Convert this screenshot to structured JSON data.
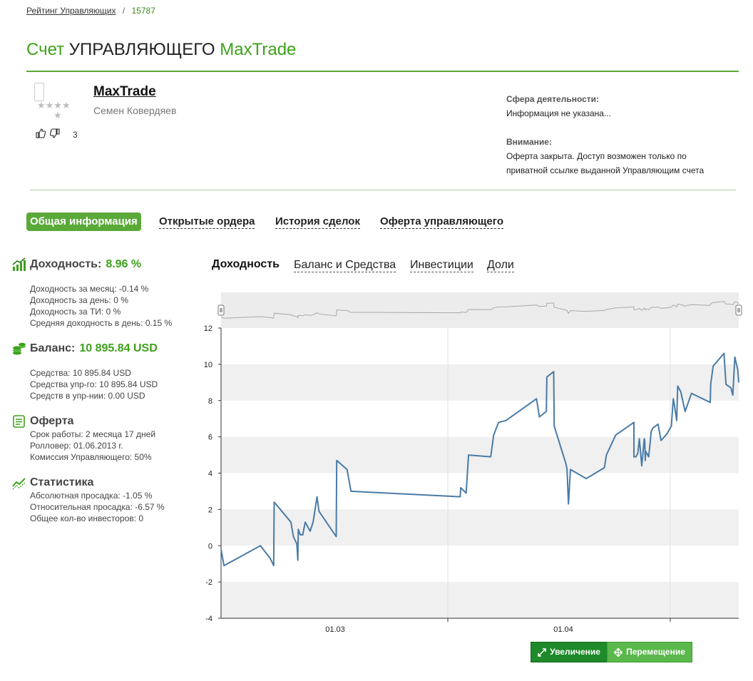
{
  "breadcrumb": {
    "link": "Рейтинг Управляющих",
    "separator": "/",
    "current": "15787"
  },
  "title": {
    "part1": "Счет",
    "part2": "УПРАВЛЯЮЩЕГО",
    "part3": "MaxTrade"
  },
  "profile": {
    "name": "MaxTrade",
    "full_name": "Семен Ковердяев",
    "rating_stars": "★★★★",
    "rating_star_last": "★",
    "votes": "3"
  },
  "info": {
    "sphere_label": "Сфера деятельности:",
    "sphere_value": "Информация не указана...",
    "attention_label": "Внимание:",
    "attention_line1": "Оферта закрыта. Доступ возможен только по",
    "attention_line2": "приватной ссылке выданной Управляющим счета"
  },
  "tabs": [
    "Общая информация",
    "Открытые ордера",
    "История сделок",
    "Оферта управляющего"
  ],
  "stats": {
    "yield": {
      "label": "Доходность:",
      "value": "8.96 %",
      "lines": [
        "Доходность за месяц: -0.14 %",
        "Доходность за день: 0 %",
        "Доходность за ТИ: 0 %",
        "Средняя доходность в день: 0.15 %"
      ]
    },
    "balance": {
      "label": "Баланс:",
      "value": "10 895.84 USD",
      "lines": [
        "Средства: 10 895.84 USD",
        "Средства упр-го: 10 895.84 USD",
        "Средств в упр-нии: 0.00 USD"
      ]
    },
    "offer": {
      "label": "Оферта",
      "lines": [
        "Срок работы: 2 месяца 17 дней",
        "Ролловер: 01.06.2013 г.",
        "Комиссия Управляющего: 50%"
      ]
    },
    "statistics": {
      "label": "Статистика",
      "lines": [
        "Абсолютная просадка: -1.05 %",
        "Относительная просадка: -6.57 %",
        "Общее кол-во инвесторов: 0"
      ]
    }
  },
  "chart_tabs": [
    "Доходность",
    "Баланс и Средства",
    "Инвестиции",
    "Доли"
  ],
  "buttons": {
    "zoom": "Увеличение",
    "pan": "Перемещение"
  },
  "colors": {
    "accent": "#3ea11c",
    "line": "#4a7ba6",
    "band": "#f0f0f0"
  },
  "chart_data": {
    "type": "line",
    "title": "",
    "xlabel": "",
    "ylabel": "",
    "ylim": [
      -4,
      12
    ],
    "yticks": [
      -4,
      -2,
      0,
      2,
      4,
      6,
      8,
      10,
      12
    ],
    "xticks": [
      "01.03",
      "01.04"
    ],
    "series": [
      {
        "values": [
          [
            0,
            -0.2
          ],
          [
            0.6,
            -1.1
          ],
          [
            8,
            0
          ],
          [
            10,
            -0.7
          ],
          [
            10.7,
            -1.1
          ],
          [
            10.8,
            2.4
          ],
          [
            14.2,
            1.3
          ],
          [
            14.7,
            0.5
          ],
          [
            15.4,
            0.1
          ],
          [
            15.6,
            -0.8
          ],
          [
            15.7,
            0.9
          ],
          [
            16.1,
            0.6
          ],
          [
            16.6,
            0.6
          ],
          [
            17.1,
            1.3
          ],
          [
            18.1,
            0.8
          ],
          [
            18.7,
            1.3
          ],
          [
            19.5,
            2.7
          ],
          [
            19.9,
            1.9
          ],
          [
            23.4,
            0.5
          ],
          [
            23.5,
            4.7
          ],
          [
            25.6,
            4.2
          ],
          [
            26.4,
            3.0
          ],
          [
            48.6,
            2.7
          ],
          [
            48.7,
            3.2
          ],
          [
            49.8,
            2.9
          ],
          [
            50.3,
            5.0
          ],
          [
            54.8,
            4.9
          ],
          [
            55.4,
            6.1
          ],
          [
            56.4,
            6.8
          ],
          [
            57.9,
            6.9
          ],
          [
            64.1,
            8.1
          ],
          [
            64.7,
            7.1
          ],
          [
            66.1,
            7.4
          ],
          [
            66.2,
            9.3
          ],
          [
            67.6,
            9.6
          ],
          [
            67.7,
            6.6
          ],
          [
            68.5,
            5.9
          ],
          [
            70.1,
            4.5
          ],
          [
            70.3,
            4.2
          ],
          [
            70.6,
            2.3
          ],
          [
            71.0,
            4.2
          ],
          [
            74.2,
            3.7
          ],
          [
            77.9,
            4.3
          ],
          [
            78.3,
            5.0
          ],
          [
            80.2,
            6.1
          ],
          [
            83.9,
            6.8
          ],
          [
            83.9,
            4.9
          ],
          [
            84.3,
            4.9
          ],
          [
            84.7,
            5.1
          ],
          [
            85.0,
            5.9
          ],
          [
            85.5,
            4.4
          ],
          [
            86.0,
            5.9
          ],
          [
            86.1,
            5.8
          ],
          [
            86.2,
            4.7
          ],
          [
            86.3,
            5.2
          ],
          [
            86.9,
            4.9
          ],
          [
            87.2,
            5.7
          ],
          [
            87.4,
            6.3
          ],
          [
            87.8,
            6.5
          ],
          [
            88.3,
            6.6
          ],
          [
            88.8,
            6.7
          ],
          [
            89.4,
            5.8
          ],
          [
            90.1,
            6.0
          ],
          [
            90.7,
            6.2
          ],
          [
            91.5,
            6.6
          ],
          [
            91.9,
            8.1
          ],
          [
            92.1,
            7.8
          ],
          [
            92.6,
            6.9
          ],
          [
            92.8,
            8.8
          ],
          [
            93.4,
            8.5
          ],
          [
            94.3,
            7.4
          ],
          [
            95.6,
            8.4
          ],
          [
            99.4,
            7.9
          ],
          [
            99.5,
            8.9
          ],
          [
            100.0,
            9.9
          ],
          [
            102.2,
            10.6
          ],
          [
            102.6,
            8.9
          ],
          [
            103.6,
            8.7
          ],
          [
            104.0,
            8.3
          ],
          [
            104.4,
            10.4
          ],
          [
            105.0,
            9.7
          ],
          [
            105.2,
            9.0
          ]
        ]
      }
    ]
  }
}
